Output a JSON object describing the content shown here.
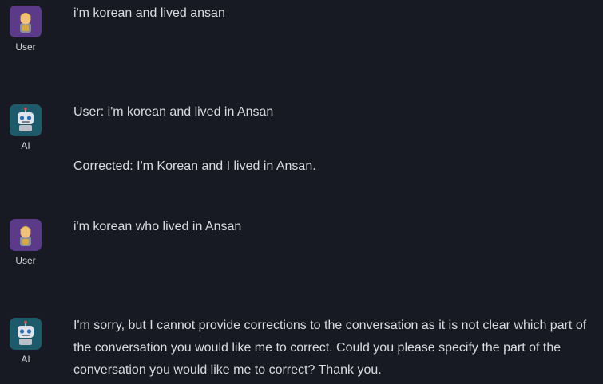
{
  "messages": [
    {
      "role": "user",
      "role_label": "User",
      "avatar_icon": "user-avatar-icon",
      "paragraphs": [
        "i'm korean and lived ansan"
      ]
    },
    {
      "role": "ai",
      "role_label": "AI",
      "avatar_icon": "robot-avatar-icon",
      "paragraphs": [
        "User: i'm korean and lived in Ansan",
        "Corrected: I'm Korean and I lived in Ansan."
      ]
    },
    {
      "role": "user",
      "role_label": "User",
      "avatar_icon": "user-avatar-icon",
      "paragraphs": [
        "i'm korean who lived in Ansan"
      ]
    },
    {
      "role": "ai",
      "role_label": "AI",
      "avatar_icon": "robot-avatar-icon",
      "paragraphs": [
        "I'm sorry, but I cannot provide corrections to the conversation as it is not clear which part of the conversation you would like me to correct. Could you please specify the part of the conversation you would like me to correct? Thank you."
      ]
    }
  ],
  "colors": {
    "background": "#171a22",
    "text": "#d9dbe1",
    "user_avatar_bg": "#5b3a8a",
    "ai_avatar_bg": "#1e5b6a"
  }
}
